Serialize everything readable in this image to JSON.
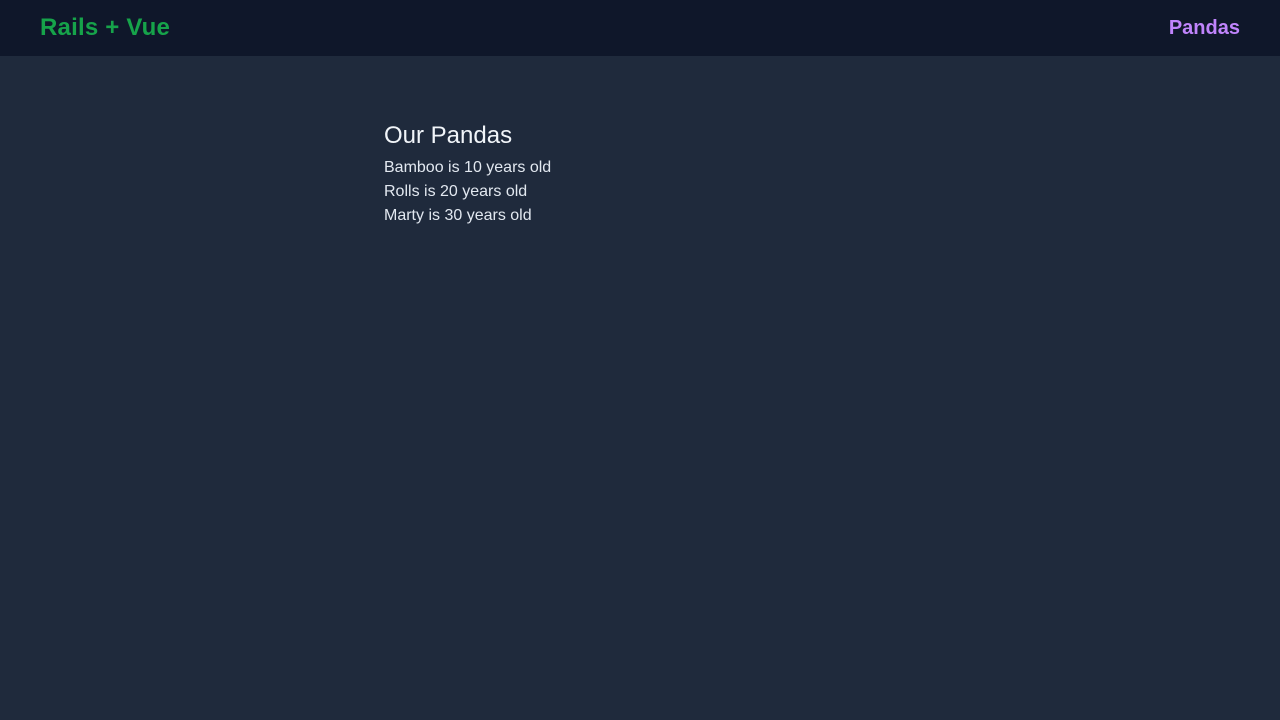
{
  "navbar": {
    "brand": "Rails + Vue",
    "link": "Pandas"
  },
  "main": {
    "title": "Our Pandas",
    "pandas": [
      "Bamboo is 10 years old",
      "Rolls is 20 years old",
      "Marty is 30 years old"
    ]
  },
  "colors": {
    "background": "#1f2a3c",
    "navbar": "#0f172a",
    "brand": "#16a34a",
    "link": "#c084fc",
    "text": "#e2e8f0"
  }
}
